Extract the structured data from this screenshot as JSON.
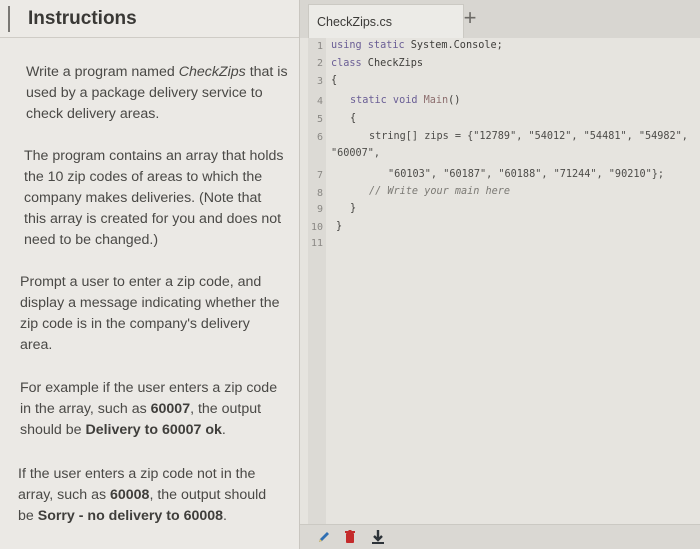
{
  "instructions": {
    "title": "Instructions",
    "p1": {
      "a": "Write a program named ",
      "b": "CheckZips",
      "c": " that is used by a package delivery service to check delivery areas."
    },
    "p2": "The program contains an array that holds the 10 zip codes of areas to which the company makes deliveries. (Note that this array is created for you and does not need to be changed.)",
    "p3": "Prompt a user to enter a zip code, and display a message indicating whether the zip code is in the company's delivery area.",
    "p4": {
      "a": "For example if the user enters a zip code in the array, such as ",
      "b": "60007",
      "c": ", the output should be ",
      "d": "Delivery to 60007 ok",
      "e": "."
    },
    "p5": {
      "a": "If the user enters a zip code not in the array, such as ",
      "b": "60008",
      "c": ", the output should be ",
      "d": "Sorry - no delivery to 60008",
      "e": "."
    }
  },
  "editor": {
    "tab_label": "CheckZips.cs",
    "add_tab": "+",
    "line_numbers": [
      "1",
      "2",
      "3",
      "4",
      "5",
      "6",
      "7",
      "8",
      "9",
      "10",
      "11"
    ],
    "code": {
      "l1_kw": "using static",
      "l1_rest": " System.Console;",
      "l2_kw": "class",
      "l2_rest": " CheckZips",
      "l3": "{",
      "l4_kw": "static void",
      "l4_fn": " Main",
      "l4_rest": "()",
      "l5": "{",
      "l6a": "string[] zips = {\"12789\", \"54012\", \"54481\", \"54982\",",
      "l6b": "\"60007\",",
      "l7": "\"60103\", \"60187\", \"60188\", \"71244\", \"90210\"};",
      "l8": "// Write your main here",
      "l9": "}",
      "l10": "}"
    }
  },
  "toolbar": {
    "pencil_icon": "pencil-icon",
    "trash_icon": "trash-icon",
    "download_icon": "download-icon"
  },
  "colors": {
    "accent_blue": "#2f6fb3",
    "trash_red": "#c42b2b",
    "download_dark": "#2d3338"
  }
}
